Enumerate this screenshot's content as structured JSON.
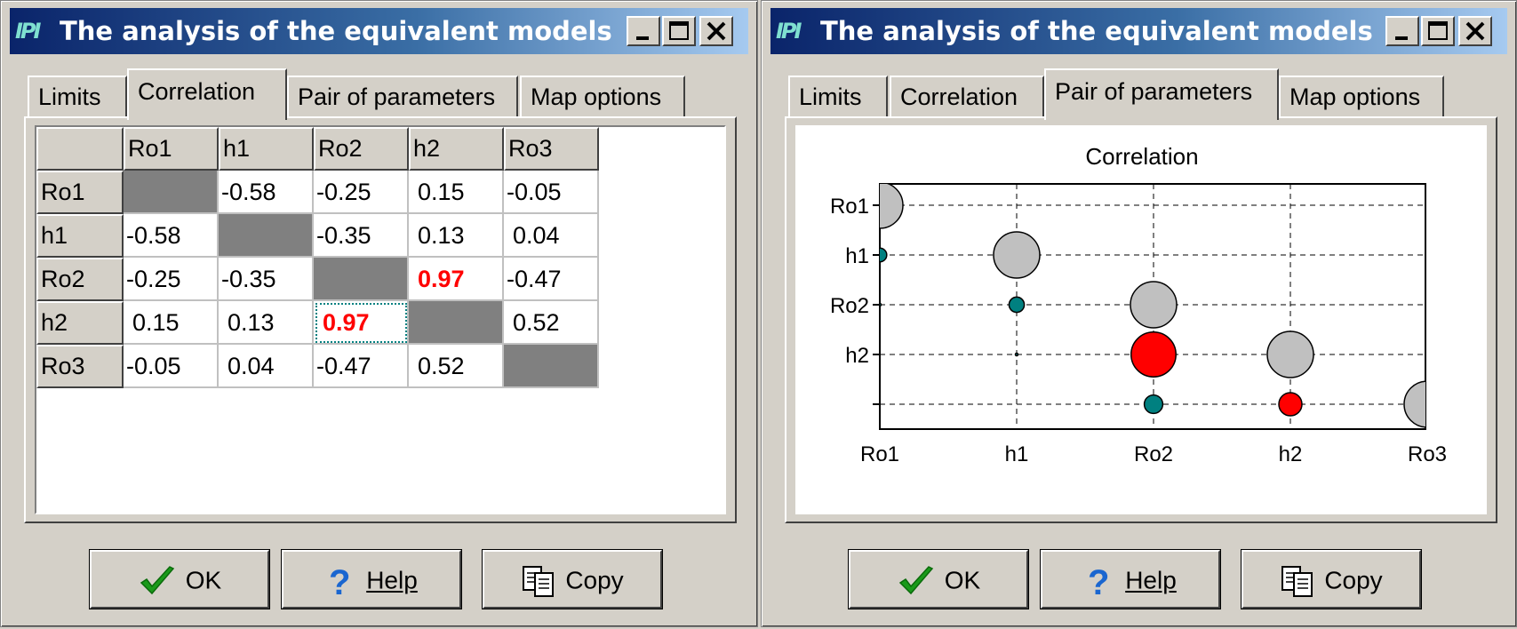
{
  "window_title": "The analysis of the equivalent models",
  "tabs": [
    "Limits",
    "Correlation",
    "Pair of parameters",
    "Map options"
  ],
  "buttons": {
    "ok": "OK",
    "help": "Help",
    "copy": "Copy"
  },
  "title_buttons": {
    "minimize": "minimize-icon",
    "maximize": "maximize-icon",
    "close": "close-icon"
  },
  "colors": {
    "highlight": "#ff0000",
    "positive": "#ff0000",
    "negative": "#008080",
    "diagonal": "#c0c0c0",
    "diag_cell": "#808080"
  },
  "matrix": {
    "headers": [
      "Ro1",
      "h1",
      "Ro2",
      "h2",
      "Ro3"
    ],
    "rows": [
      {
        "label": "Ro1",
        "cells": [
          "",
          "-0.58",
          "-0.25",
          "0.15",
          "-0.05"
        ]
      },
      {
        "label": "h1",
        "cells": [
          "-0.58",
          "",
          "-0.35",
          "0.13",
          "0.04"
        ]
      },
      {
        "label": "Ro2",
        "cells": [
          "-0.25",
          "-0.35",
          "",
          "0.97",
          "-0.47"
        ]
      },
      {
        "label": "h2",
        "cells": [
          "0.15",
          "0.13",
          "0.97",
          "",
          "0.52"
        ]
      },
      {
        "label": "Ro3",
        "cells": [
          "-0.05",
          "0.04",
          "-0.47",
          "0.52",
          ""
        ]
      }
    ],
    "highlighted_value": "0.97",
    "focused_cell": {
      "row": 3,
      "col": 2
    }
  },
  "chart_data": {
    "type": "scatter",
    "title": "Correlation",
    "x_ticks": [
      "Ro1",
      "h1",
      "Ro2",
      "h2",
      "Ro3"
    ],
    "y_ticks": [
      "Ro1",
      "h1",
      "Ro2",
      "h2",
      ""
    ],
    "grid": true,
    "points": [
      {
        "x": "Ro1",
        "y": "Ro1",
        "r": 1.0,
        "color": "#c0c0c0"
      },
      {
        "x": "Ro1",
        "y": "h1",
        "r": 0.3,
        "color": "#008080"
      },
      {
        "x": "h1",
        "y": "h1",
        "r": 1.0,
        "color": "#c0c0c0"
      },
      {
        "x": "Ro1",
        "y": "Ro2",
        "r": 0.05,
        "color": "#008080"
      },
      {
        "x": "h1",
        "y": "Ro2",
        "r": 0.33,
        "color": "#008080"
      },
      {
        "x": "Ro2",
        "y": "Ro2",
        "r": 1.0,
        "color": "#c0c0c0"
      },
      {
        "x": "h1",
        "y": "h2",
        "r": 0.04,
        "color": "#008080"
      },
      {
        "x": "Ro2",
        "y": "h2",
        "r": 0.97,
        "color": "#ff0000"
      },
      {
        "x": "h2",
        "y": "h2",
        "r": 1.0,
        "color": "#c0c0c0"
      },
      {
        "x": "Ro2",
        "y": "",
        "r": 0.4,
        "color": "#008080"
      },
      {
        "x": "h2",
        "y": "",
        "r": 0.5,
        "color": "#ff0000"
      },
      {
        "x": "Ro3",
        "y": "",
        "r": 1.0,
        "color": "#c0c0c0"
      }
    ]
  }
}
